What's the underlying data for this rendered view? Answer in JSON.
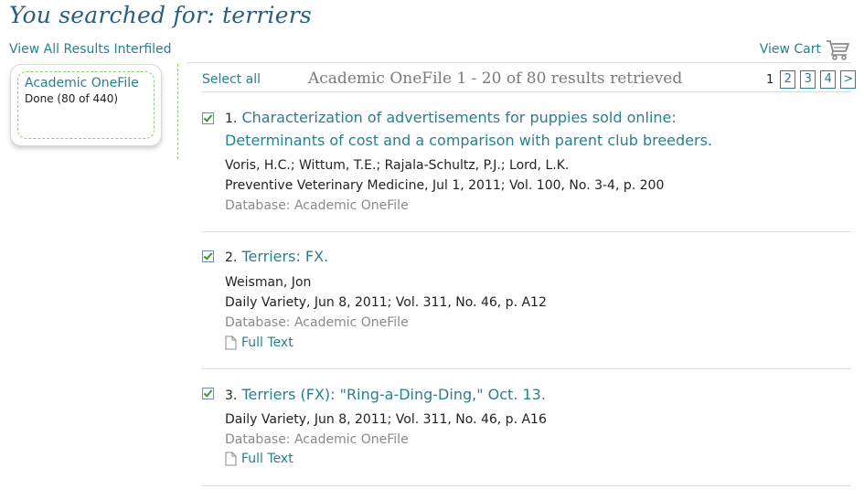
{
  "header": {
    "search_title": "You searched for: terriers",
    "view_all_label": "View All Results Interfiled",
    "view_cart_label": "View Cart"
  },
  "source_box": {
    "name": "Academic OneFile",
    "status": "Done (80 of 440)"
  },
  "results_header": {
    "select_all_label": "Select all",
    "summary": "Academic OneFile 1 - 20 of 80 results retrieved",
    "pager": {
      "current": "1",
      "pages": [
        "2",
        "3",
        "4"
      ],
      "next": ">"
    }
  },
  "results": [
    {
      "number": "1.",
      "title_line1": "Characterization of advertisements for puppies sold online:",
      "title_line2": "Determinants of cost and a comparison with parent club breeders.",
      "authors": "Voris, H.C.;  Wittum, T.E.;  Rajala-Schultz, P.J.;  Lord, L.K.",
      "citation": "Preventive Veterinary Medicine, Jul 1, 2011; Vol. 100, No. 3-4, p. 200",
      "database": "Database: Academic OneFile",
      "checked": true
    },
    {
      "number": "2.",
      "title_line1": "Terriers: FX.",
      "authors": "Weisman, Jon",
      "citation": "Daily Variety, Jun 8, 2011; Vol. 311, No. 46, p. A12",
      "database": "Database: Academic OneFile",
      "full_text_label": "Full Text",
      "checked": true
    },
    {
      "number": "3.",
      "title_line1": "Terriers (FX): \"Ring-a-Ding-Ding,\" Oct. 13.",
      "citation": "Daily Variety, Jun 8, 2011; Vol. 311, No. 46, p. A16",
      "database": "Database: Academic OneFile",
      "full_text_label": "Full Text",
      "checked": true
    }
  ],
  "icons": {
    "cart": "shopping-cart-icon",
    "document": "document-icon",
    "checkbox": "checkbox-checked-icon"
  },
  "colors": {
    "title": "#2a5e7e",
    "link": "#2a7f8f",
    "dashed_green": "#8fce7a",
    "check_green": "#2e9a2e"
  }
}
